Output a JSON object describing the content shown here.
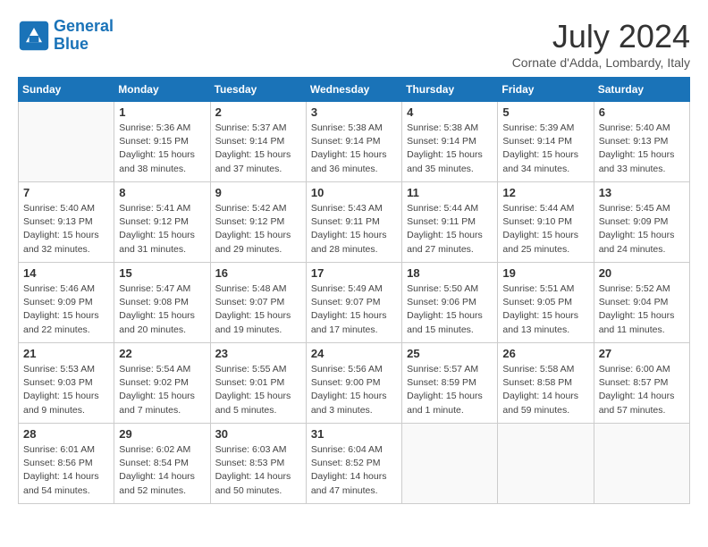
{
  "header": {
    "logo_line1": "General",
    "logo_line2": "Blue",
    "month_title": "July 2024",
    "subtitle": "Cornate d'Adda, Lombardy, Italy"
  },
  "weekdays": [
    "Sunday",
    "Monday",
    "Tuesday",
    "Wednesday",
    "Thursday",
    "Friday",
    "Saturday"
  ],
  "weeks": [
    [
      {
        "day": "",
        "empty": true
      },
      {
        "day": "1",
        "sunrise": "5:36 AM",
        "sunset": "9:15 PM",
        "daylight": "15 hours and 38 minutes."
      },
      {
        "day": "2",
        "sunrise": "5:37 AM",
        "sunset": "9:14 PM",
        "daylight": "15 hours and 37 minutes."
      },
      {
        "day": "3",
        "sunrise": "5:38 AM",
        "sunset": "9:14 PM",
        "daylight": "15 hours and 36 minutes."
      },
      {
        "day": "4",
        "sunrise": "5:38 AM",
        "sunset": "9:14 PM",
        "daylight": "15 hours and 35 minutes."
      },
      {
        "day": "5",
        "sunrise": "5:39 AM",
        "sunset": "9:14 PM",
        "daylight": "15 hours and 34 minutes."
      },
      {
        "day": "6",
        "sunrise": "5:40 AM",
        "sunset": "9:13 PM",
        "daylight": "15 hours and 33 minutes."
      }
    ],
    [
      {
        "day": "7",
        "sunrise": "5:40 AM",
        "sunset": "9:13 PM",
        "daylight": "15 hours and 32 minutes."
      },
      {
        "day": "8",
        "sunrise": "5:41 AM",
        "sunset": "9:12 PM",
        "daylight": "15 hours and 31 minutes."
      },
      {
        "day": "9",
        "sunrise": "5:42 AM",
        "sunset": "9:12 PM",
        "daylight": "15 hours and 29 minutes."
      },
      {
        "day": "10",
        "sunrise": "5:43 AM",
        "sunset": "9:11 PM",
        "daylight": "15 hours and 28 minutes."
      },
      {
        "day": "11",
        "sunrise": "5:44 AM",
        "sunset": "9:11 PM",
        "daylight": "15 hours and 27 minutes."
      },
      {
        "day": "12",
        "sunrise": "5:44 AM",
        "sunset": "9:10 PM",
        "daylight": "15 hours and 25 minutes."
      },
      {
        "day": "13",
        "sunrise": "5:45 AM",
        "sunset": "9:09 PM",
        "daylight": "15 hours and 24 minutes."
      }
    ],
    [
      {
        "day": "14",
        "sunrise": "5:46 AM",
        "sunset": "9:09 PM",
        "daylight": "15 hours and 22 minutes."
      },
      {
        "day": "15",
        "sunrise": "5:47 AM",
        "sunset": "9:08 PM",
        "daylight": "15 hours and 20 minutes."
      },
      {
        "day": "16",
        "sunrise": "5:48 AM",
        "sunset": "9:07 PM",
        "daylight": "15 hours and 19 minutes."
      },
      {
        "day": "17",
        "sunrise": "5:49 AM",
        "sunset": "9:07 PM",
        "daylight": "15 hours and 17 minutes."
      },
      {
        "day": "18",
        "sunrise": "5:50 AM",
        "sunset": "9:06 PM",
        "daylight": "15 hours and 15 minutes."
      },
      {
        "day": "19",
        "sunrise": "5:51 AM",
        "sunset": "9:05 PM",
        "daylight": "15 hours and 13 minutes."
      },
      {
        "day": "20",
        "sunrise": "5:52 AM",
        "sunset": "9:04 PM",
        "daylight": "15 hours and 11 minutes."
      }
    ],
    [
      {
        "day": "21",
        "sunrise": "5:53 AM",
        "sunset": "9:03 PM",
        "daylight": "15 hours and 9 minutes."
      },
      {
        "day": "22",
        "sunrise": "5:54 AM",
        "sunset": "9:02 PM",
        "daylight": "15 hours and 7 minutes."
      },
      {
        "day": "23",
        "sunrise": "5:55 AM",
        "sunset": "9:01 PM",
        "daylight": "15 hours and 5 minutes."
      },
      {
        "day": "24",
        "sunrise": "5:56 AM",
        "sunset": "9:00 PM",
        "daylight": "15 hours and 3 minutes."
      },
      {
        "day": "25",
        "sunrise": "5:57 AM",
        "sunset": "8:59 PM",
        "daylight": "15 hours and 1 minute."
      },
      {
        "day": "26",
        "sunrise": "5:58 AM",
        "sunset": "8:58 PM",
        "daylight": "14 hours and 59 minutes."
      },
      {
        "day": "27",
        "sunrise": "6:00 AM",
        "sunset": "8:57 PM",
        "daylight": "14 hours and 57 minutes."
      }
    ],
    [
      {
        "day": "28",
        "sunrise": "6:01 AM",
        "sunset": "8:56 PM",
        "daylight": "14 hours and 54 minutes."
      },
      {
        "day": "29",
        "sunrise": "6:02 AM",
        "sunset": "8:54 PM",
        "daylight": "14 hours and 52 minutes."
      },
      {
        "day": "30",
        "sunrise": "6:03 AM",
        "sunset": "8:53 PM",
        "daylight": "14 hours and 50 minutes."
      },
      {
        "day": "31",
        "sunrise": "6:04 AM",
        "sunset": "8:52 PM",
        "daylight": "14 hours and 47 minutes."
      },
      {
        "day": "",
        "empty": true
      },
      {
        "day": "",
        "empty": true
      },
      {
        "day": "",
        "empty": true
      }
    ]
  ]
}
